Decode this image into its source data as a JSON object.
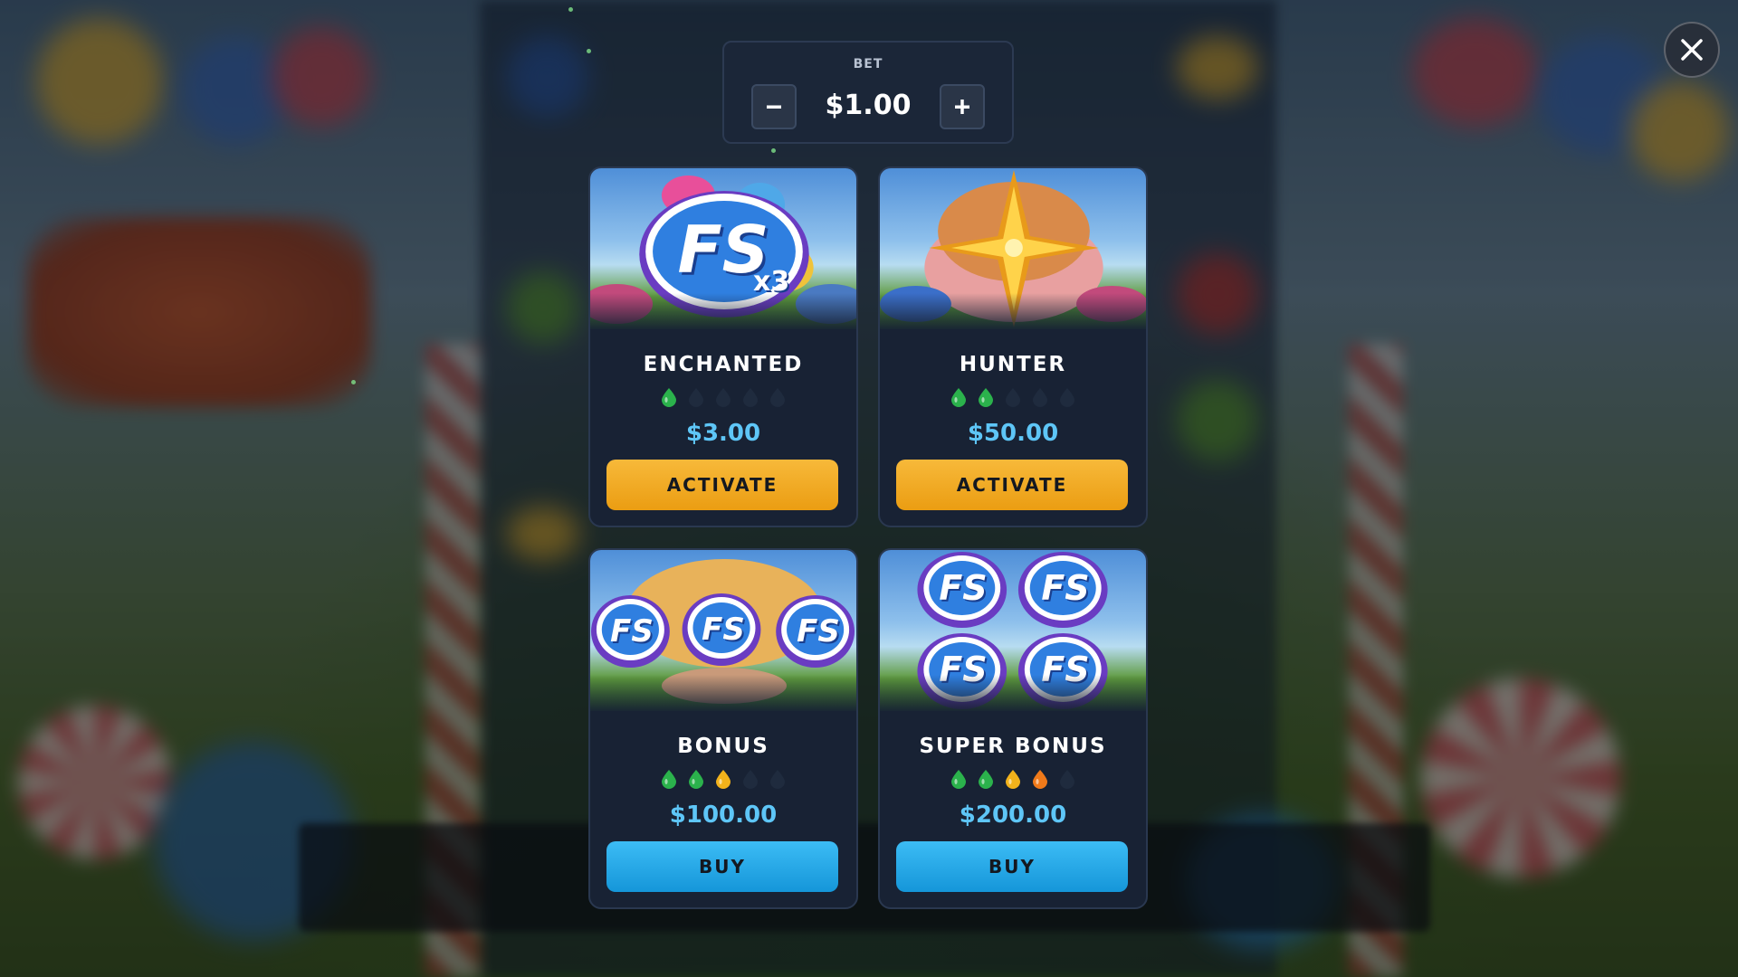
{
  "bet": {
    "label": "BET",
    "value": "$1.00",
    "decrease_icon": "minus-icon",
    "increase_icon": "plus-icon"
  },
  "close": {
    "icon": "close-icon"
  },
  "cards": [
    {
      "title": "ENCHANTED",
      "price": "$3.00",
      "button": "ACTIVATE",
      "button_style": "gold",
      "art_badge": "FS",
      "art_multiplier": "x3",
      "volatility": [
        "green",
        "empty",
        "empty",
        "empty",
        "empty"
      ]
    },
    {
      "title": "HUNTER",
      "price": "$50.00",
      "button": "ACTIVATE",
      "button_style": "gold",
      "art_badge": "",
      "art_multiplier": "",
      "volatility": [
        "green",
        "green",
        "empty",
        "empty",
        "empty"
      ]
    },
    {
      "title": "BONUS",
      "price": "$100.00",
      "button": "BUY",
      "button_style": "blue",
      "art_badge": "FS",
      "art_multiplier": "",
      "volatility": [
        "green",
        "green",
        "yellow",
        "empty",
        "empty"
      ]
    },
    {
      "title": "SUPER BONUS",
      "price": "$200.00",
      "button": "BUY",
      "button_style": "blue",
      "art_badge": "FS",
      "art_multiplier": "",
      "volatility": [
        "green",
        "green",
        "yellow",
        "orange",
        "empty"
      ]
    }
  ],
  "colors": {
    "pip_green": "#2bb24c",
    "pip_yellow": "#f2b21b",
    "pip_orange": "#f07a1a",
    "pip_empty": "#1f2b3e",
    "price": "#5ec6f7",
    "activate": "#f0a423",
    "buy": "#22a9ea"
  }
}
